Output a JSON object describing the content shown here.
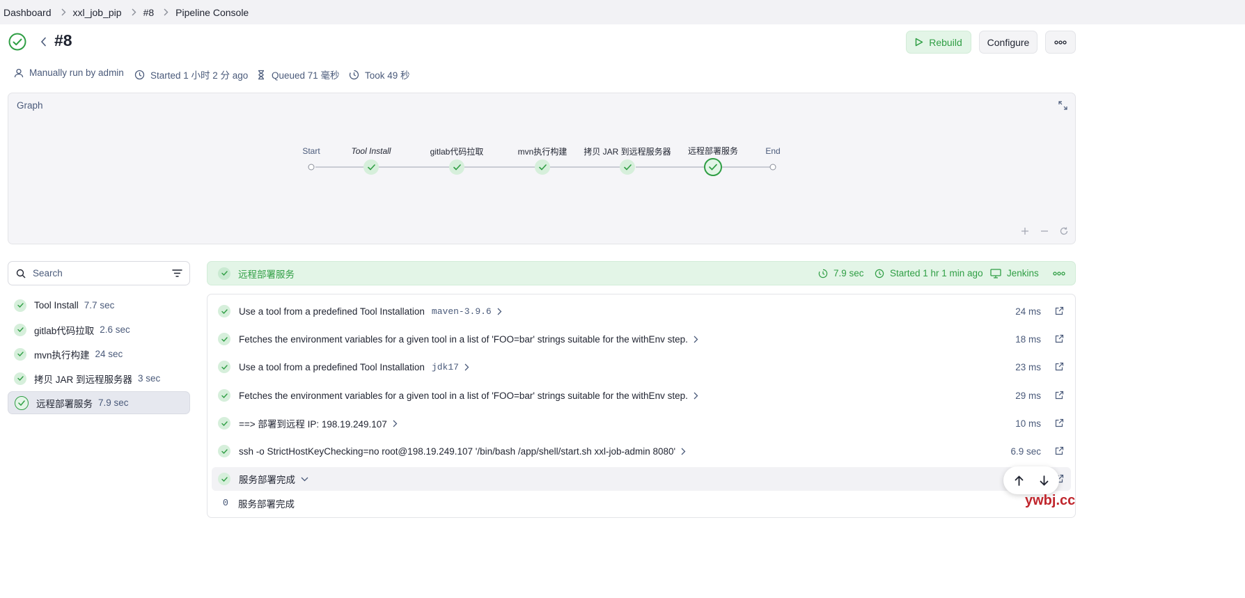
{
  "breadcrumb": {
    "items": [
      "Dashboard",
      "xxl_job_pip",
      "#8",
      "Pipeline Console"
    ]
  },
  "header": {
    "title": "#8",
    "rebuild_label": "Rebuild",
    "configure_label": "Configure",
    "more_icon": "ellipsis-icon"
  },
  "meta": {
    "run_by": "Manually run by admin",
    "started": "Started 1 小时 2 分 ago",
    "queued": "Queued 71 毫秒",
    "took": "Took 49 秒"
  },
  "graph": {
    "title": "Graph",
    "start_label": "Start",
    "end_label": "End",
    "stages": [
      "Tool Install",
      "gitlab代码拉取",
      "mvn执行构建",
      "拷贝 JAR 到远程服务器",
      "远程部署服务"
    ],
    "selected_stage": "远程部署服务"
  },
  "search": {
    "placeholder": "Search"
  },
  "stage_list": [
    {
      "name": "Tool Install",
      "duration": "7.7 sec"
    },
    {
      "name": "gitlab代码拉取",
      "duration": "2.6 sec"
    },
    {
      "name": "mvn执行构建",
      "duration": "24 sec"
    },
    {
      "name": "拷贝 JAR 到远程服务器",
      "duration": "3 sec"
    },
    {
      "name": "远程部署服务",
      "duration": "7.9 sec"
    }
  ],
  "stage_detail": {
    "name": "远程部署服务",
    "duration": "7.9 sec",
    "started": "Started 1 hr 1 min ago",
    "agent": "Jenkins"
  },
  "steps": [
    {
      "text": "Use a tool from a predefined Tool Installation",
      "param": "maven-3.9.6",
      "duration": "24 ms"
    },
    {
      "text": "Fetches the environment variables for a given tool in a list of 'FOO=bar' strings suitable for the withEnv step.",
      "param": "",
      "duration": "18 ms"
    },
    {
      "text": "Use a tool from a predefined Tool Installation",
      "param": "jdk17",
      "duration": "23 ms"
    },
    {
      "text": "Fetches the environment variables for a given tool in a list of 'FOO=bar' strings suitable for the withEnv step.",
      "param": "",
      "duration": "29 ms"
    },
    {
      "text": "==> 部署到远程 IP: 198.19.249.107",
      "param": "",
      "duration": "10 ms"
    },
    {
      "text": "ssh -o StrictHostKeyChecking=no root@198.19.249.107 '/bin/bash /app/shell/start.sh xxl-job-admin 8080'",
      "param": "",
      "duration": "6.9 sec"
    },
    {
      "text": "服务部署完成",
      "param": "",
      "duration": ""
    }
  ],
  "log": {
    "line_number": "0",
    "text": "服务部署完成"
  },
  "watermark": "ywbj.cc",
  "colors": {
    "success": "#2f9e44",
    "success_bg": "#e3f5e7",
    "muted_text": "#4a5a7a"
  }
}
